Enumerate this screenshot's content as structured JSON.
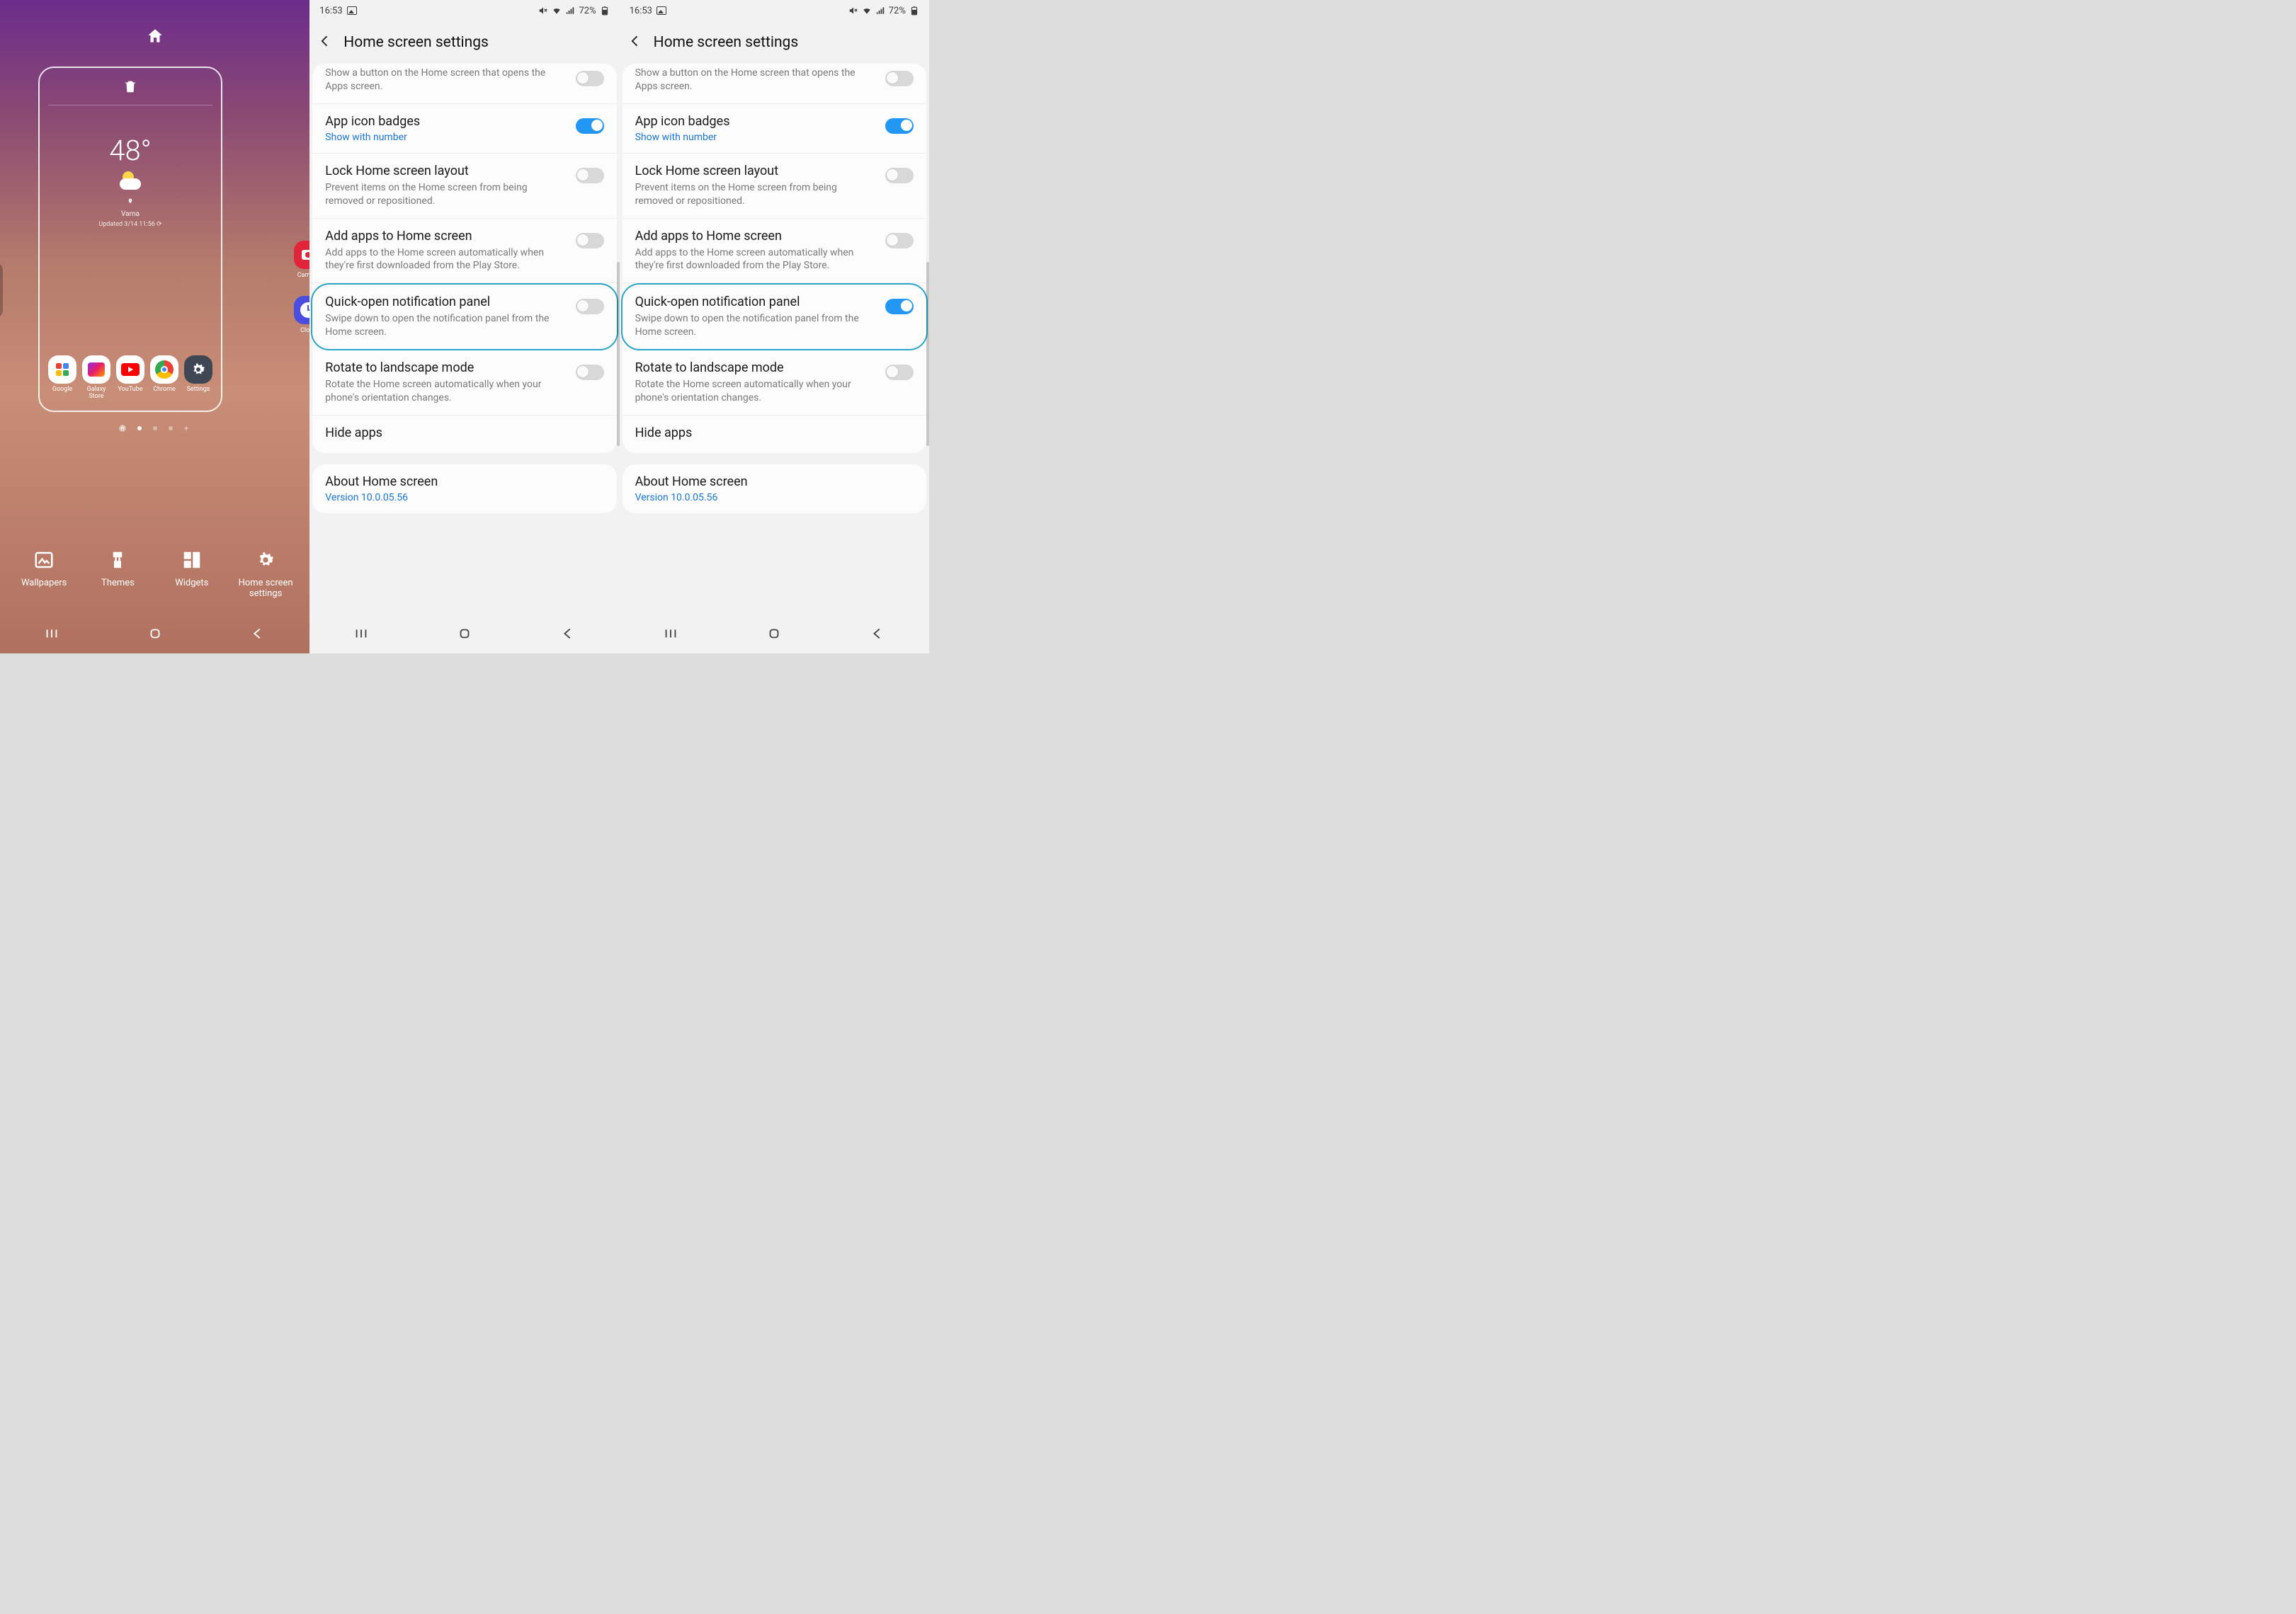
{
  "panel1": {
    "weather": {
      "temp": "48°",
      "city": "Varna",
      "updated": "Updated 3/14 11:56 ⟳"
    },
    "home_apps": [
      {
        "label": "Google",
        "name": "google"
      },
      {
        "label": "Galaxy Store",
        "name": "galaxy-store"
      },
      {
        "label": "YouTube",
        "name": "youtube"
      },
      {
        "label": "Chrome",
        "name": "chrome"
      },
      {
        "label": "Settings",
        "name": "settings"
      }
    ],
    "side_apps": [
      {
        "label": "Camera",
        "name": "camera"
      },
      {
        "label": "Clock",
        "name": "clock"
      }
    ],
    "bottom_options": [
      {
        "label": "Wallpapers",
        "name": "wallpapers"
      },
      {
        "label": "Themes",
        "name": "themes"
      },
      {
        "label": "Widgets",
        "name": "widgets"
      },
      {
        "label": "Home screen settings",
        "name": "home-screen-settings"
      }
    ]
  },
  "status": {
    "time": "16:53",
    "battery": "72%"
  },
  "settings_header": "Home screen settings",
  "items": {
    "apps_button_sub": "Show a button on the Home screen that opens the Apps screen.",
    "badges_title": "App icon badges",
    "badges_sub": "Show with number",
    "lock_title": "Lock Home screen layout",
    "lock_sub": "Prevent items on the Home screen from being removed or repositioned.",
    "add_title": "Add apps to Home screen",
    "add_sub": "Add apps to the Home screen automatically when they're first downloaded from the Play Store.",
    "quick_title": "Quick-open notification panel",
    "quick_sub": "Swipe down to open the notification panel from the Home screen.",
    "rotate_title": "Rotate to landscape mode",
    "rotate_sub": "Rotate the Home screen automatically when your phone's orientation changes.",
    "hide_title": "Hide apps",
    "about_title": "About Home screen",
    "about_sub": "Version 10.0.05.56"
  }
}
